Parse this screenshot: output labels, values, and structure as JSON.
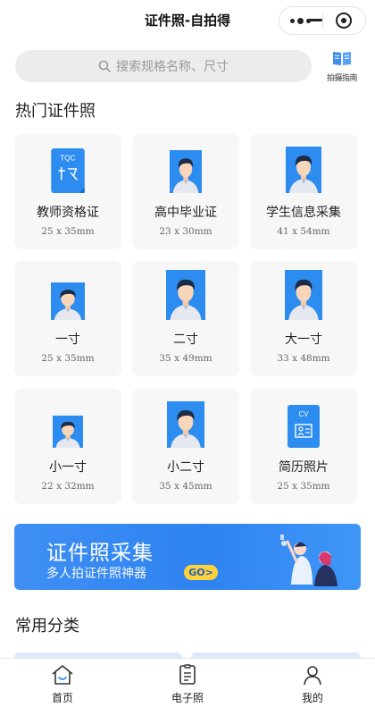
{
  "titlebar": {
    "title": "证件照-自拍得"
  },
  "search": {
    "placeholder": "搜索规格名称、尺寸"
  },
  "guide": {
    "label": "拍摄指南"
  },
  "hot_section": {
    "title": "热门证件照"
  },
  "cards": [
    {
      "name": "教师资格证",
      "size": "25 x 35mm",
      "photo": "tqc-doc"
    },
    {
      "name": "高中毕业证",
      "size": "23 x 30mm",
      "photo": "portrait"
    },
    {
      "name": "学生信息采集",
      "size": "41 x 54mm",
      "photo": "portrait"
    },
    {
      "name": "一寸",
      "size": "25 x 35mm",
      "photo": "portrait"
    },
    {
      "name": "二寸",
      "size": "35 x 49mm",
      "photo": "portrait"
    },
    {
      "name": "大一寸",
      "size": "33 x 48mm",
      "photo": "portrait"
    },
    {
      "name": "小一寸",
      "size": "22 x 32mm",
      "photo": "portrait"
    },
    {
      "name": "小二寸",
      "size": "35 x 45mm",
      "photo": "portrait"
    },
    {
      "name": "简历照片",
      "size": "25 x 35mm",
      "photo": "cv-doc"
    }
  ],
  "tqc_icon": {
    "text": "TQC"
  },
  "cv_icon": {
    "text": "CV"
  },
  "banner": {
    "title": "证件照采集",
    "subtitle": "多人拍证件照神器",
    "cta": "GO>"
  },
  "common_section": {
    "title": "常用分类"
  },
  "tabs": [
    {
      "label": "首页",
      "icon": "home-icon"
    },
    {
      "label": "电子照",
      "icon": "document-icon"
    },
    {
      "label": "我的",
      "icon": "user-icon"
    }
  ],
  "colors": {
    "photo_bg": "#2d8cf0",
    "banner": "#2f83f0",
    "go_badge": "#ffd23b"
  }
}
